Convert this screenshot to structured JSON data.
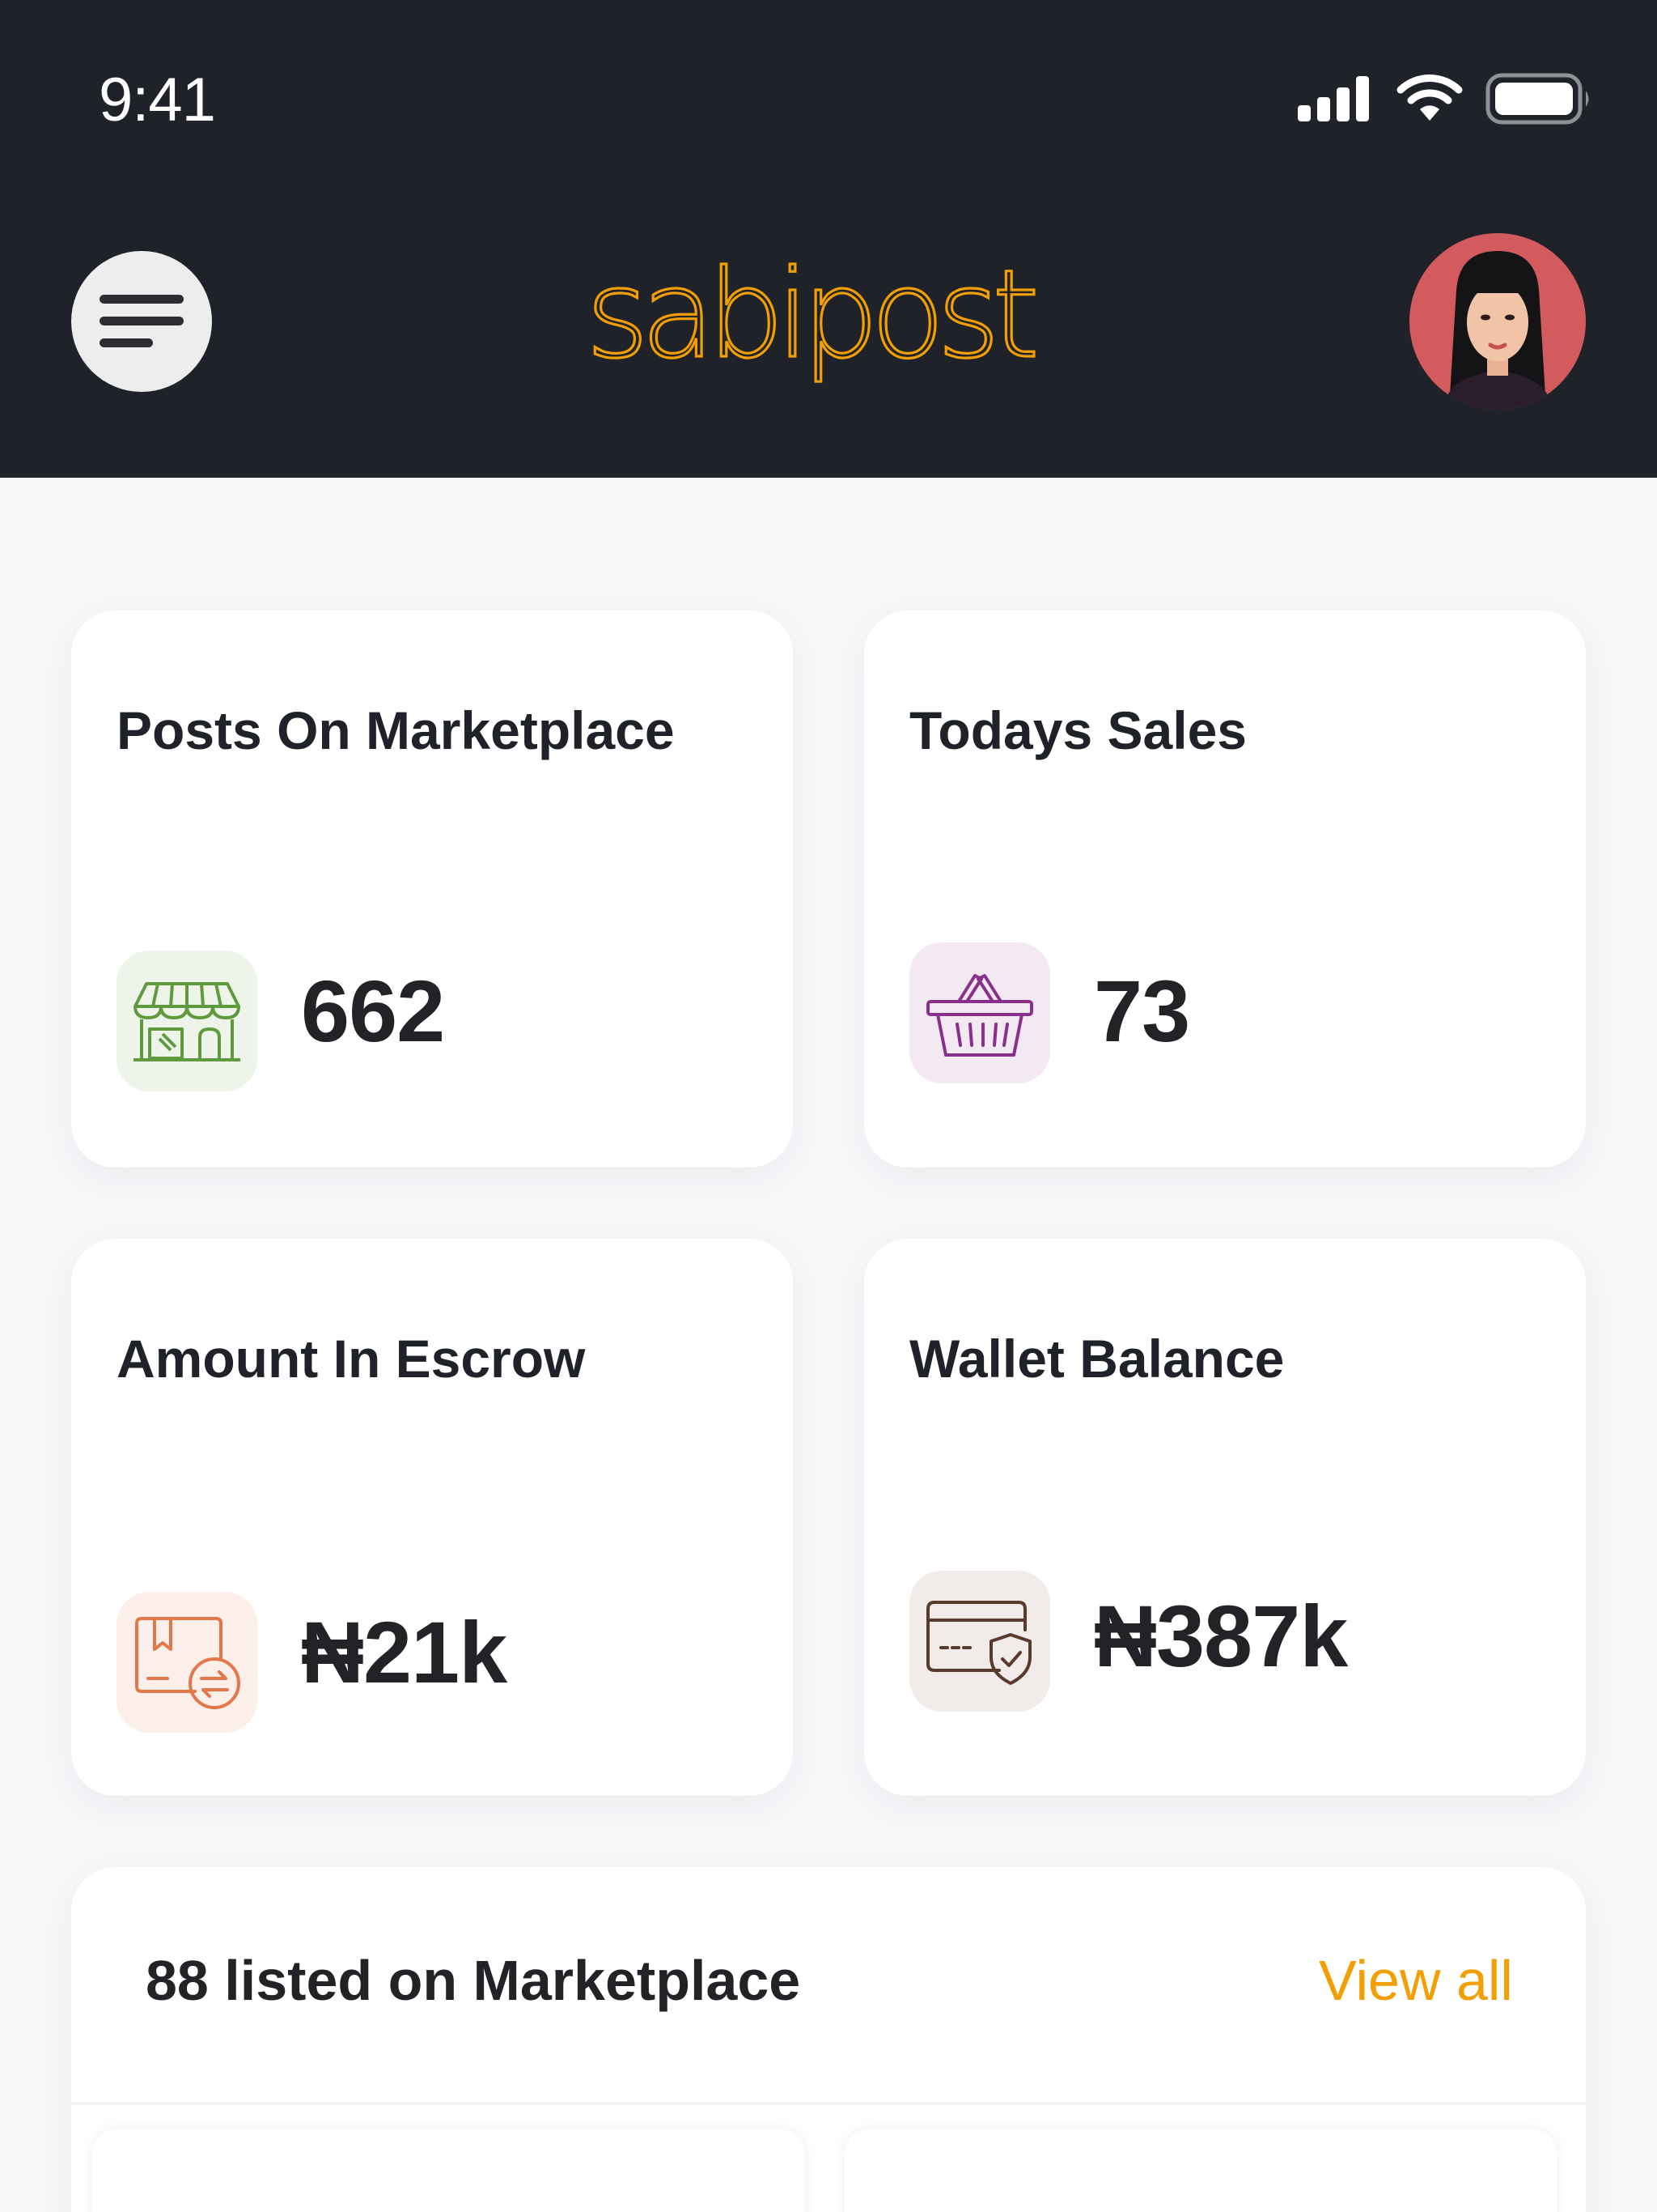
{
  "status_bar": {
    "time": "9:41",
    "icons": [
      "signal-icon",
      "wifi-icon",
      "battery-icon"
    ]
  },
  "header": {
    "menu_icon": "hamburger-icon",
    "logo_text": "sabipost",
    "avatar": "user-avatar"
  },
  "colors": {
    "header_bg": "#1f2229",
    "brand": "#f29f05",
    "page_bg": "#f5f7f9",
    "card_bg": "#ffffff"
  },
  "stats": [
    {
      "title": "Posts On Marketplace",
      "value": "662",
      "icon": "storefront-icon",
      "icon_color": "#5f9a3e",
      "tile_color": "#eef4ea"
    },
    {
      "title": "Todays Sales",
      "value": "73",
      "icon": "basket-icon",
      "icon_color": "#8a2f8c",
      "tile_color": "#f3e9f3"
    },
    {
      "title": "Amount In Escrow",
      "value": "₦21k",
      "icon": "package-exchange-icon",
      "icon_color": "#e3764a",
      "tile_color": "#fcefe9"
    },
    {
      "title": "Wallet Balance",
      "value": "₦387k",
      "icon": "card-shield-icon",
      "icon_color": "#5a3a2d",
      "tile_color": "#f1ece9"
    }
  ],
  "listed": {
    "title": "88 listed on Marketplace",
    "view_all": "View all"
  }
}
